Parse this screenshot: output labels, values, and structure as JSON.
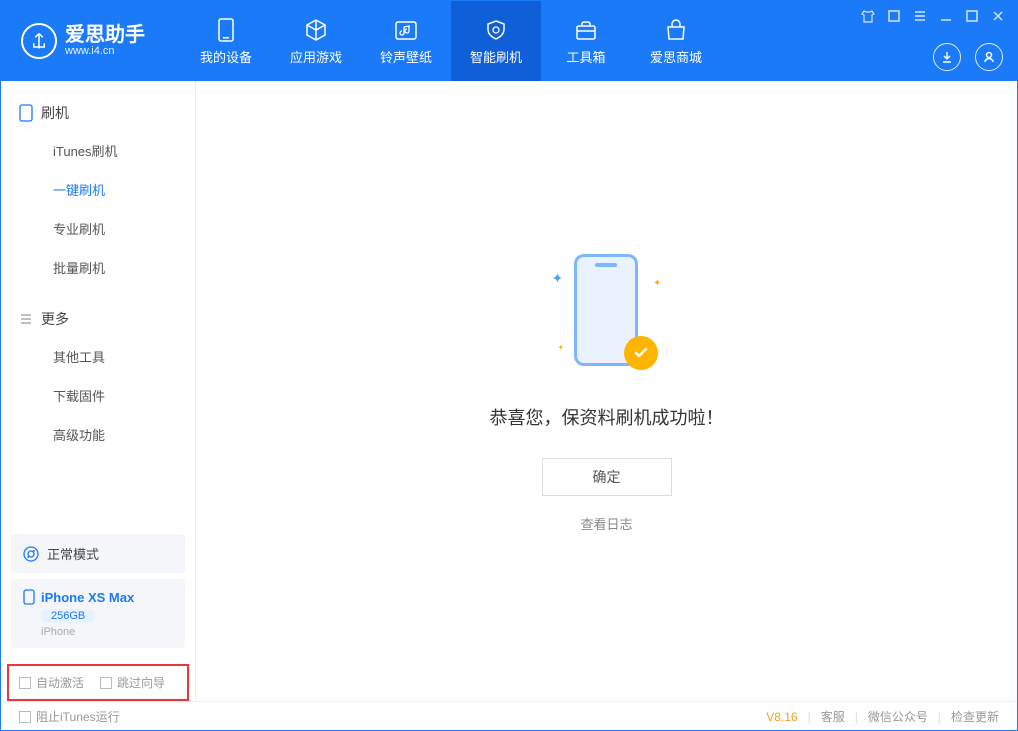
{
  "app": {
    "name": "爱思助手",
    "url": "www.i4.cn"
  },
  "nav": [
    {
      "label": "我的设备"
    },
    {
      "label": "应用游戏"
    },
    {
      "label": "铃声壁纸"
    },
    {
      "label": "智能刷机"
    },
    {
      "label": "工具箱"
    },
    {
      "label": "爱思商城"
    }
  ],
  "sidebar": {
    "section1": {
      "title": "刷机",
      "items": [
        "iTunes刷机",
        "一键刷机",
        "专业刷机",
        "批量刷机"
      ]
    },
    "section2": {
      "title": "更多",
      "items": [
        "其他工具",
        "下载固件",
        "高级功能"
      ]
    }
  },
  "device": {
    "mode": "正常模式",
    "name": "iPhone XS Max",
    "storage": "256GB",
    "type": "iPhone"
  },
  "options": {
    "auto_activate": "自动激活",
    "skip_guide": "跳过向导"
  },
  "main": {
    "success_text": "恭喜您，保资料刷机成功啦！",
    "ok_button": "确定",
    "view_log": "查看日志"
  },
  "footer": {
    "block_itunes": "阻止iTunes运行",
    "version": "V8.16",
    "support": "客服",
    "wechat": "微信公众号",
    "check_update": "检查更新"
  }
}
